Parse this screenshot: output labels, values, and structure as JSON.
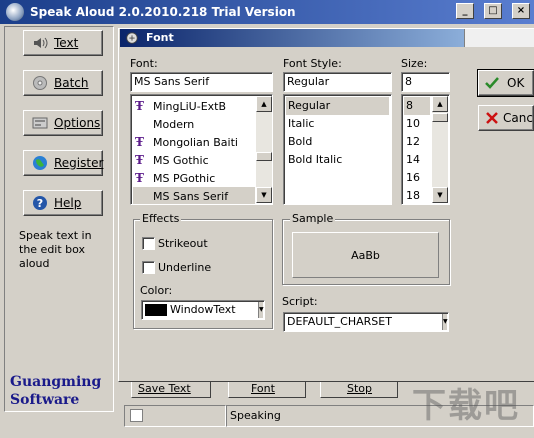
{
  "main_window": {
    "title": "Speak Aloud 2.0.2010.218 Trial Version",
    "caption_buttons": {
      "minimize": "_",
      "maximize": "□",
      "close": "×"
    }
  },
  "sidebar": {
    "buttons": [
      {
        "label": "Text",
        "icon": "speaker-icon"
      },
      {
        "label": "Batch",
        "icon": "disc-icon"
      },
      {
        "label": "Options",
        "icon": "options-icon"
      },
      {
        "label": "Register",
        "icon": "globe-icon"
      },
      {
        "label": "Help",
        "icon": "help-icon"
      }
    ],
    "description": "Speak text in the edit box aloud",
    "brand_line1": "Guangming",
    "brand_line2": "Software"
  },
  "font_dialog": {
    "title": "Font",
    "font_label": "Font:",
    "font_value": "MS Sans Serif",
    "font_list": [
      {
        "name": "MingLiU-ExtB",
        "truetype": true,
        "selected": false
      },
      {
        "name": "Modern",
        "truetype": false,
        "selected": false
      },
      {
        "name": "Mongolian Baiti",
        "truetype": true,
        "selected": false
      },
      {
        "name": "MS Gothic",
        "truetype": true,
        "selected": false
      },
      {
        "name": "MS PGothic",
        "truetype": true,
        "selected": false
      },
      {
        "name": "MS Sans Serif",
        "truetype": false,
        "selected": true
      }
    ],
    "style_label": "Font Style:",
    "style_value": "Regular",
    "style_list": [
      {
        "name": "Regular",
        "selected": true
      },
      {
        "name": "Italic",
        "selected": false
      },
      {
        "name": "Bold",
        "selected": false
      },
      {
        "name": "Bold Italic",
        "selected": false
      }
    ],
    "size_label": "Size:",
    "size_value": "8",
    "size_list": [
      {
        "name": "8",
        "selected": true
      },
      {
        "name": "10",
        "selected": false
      },
      {
        "name": "12",
        "selected": false
      },
      {
        "name": "14",
        "selected": false
      },
      {
        "name": "16",
        "selected": false
      },
      {
        "name": "18",
        "selected": false
      }
    ],
    "ok_label": "OK",
    "cancel_label": "Cance",
    "effects_title": "Effects",
    "strikeout_label": "Strikeout",
    "strikeout_checked": false,
    "underline_label": "Underline",
    "underline_checked": false,
    "color_label": "Color:",
    "color_value": "WindowText",
    "color_swatch": "#000000",
    "sample_title": "Sample",
    "sample_text": "AaBb",
    "script_label": "Script:",
    "script_value": "DEFAULT_CHARSET"
  },
  "bottom_bar": {
    "save_text_label": "Save Text",
    "font_label": "Font",
    "stop_label": "Stop",
    "status_text": "Speaking"
  },
  "watermark": "下载吧",
  "colors": {
    "window_face": "#d4d0c8",
    "title_bar": "#1b3e8a",
    "brand_text": "#1a1a8a",
    "truetype_icon": "#5a1a8a",
    "cancel_x": "#cc1111",
    "ok_check": "#2a8a2a"
  }
}
